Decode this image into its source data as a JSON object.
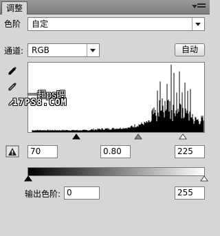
{
  "panel": {
    "tab_title": "调整"
  },
  "preset": {
    "label": "色阶",
    "value": "自定"
  },
  "channel": {
    "label": "通道:",
    "value": "RGB"
  },
  "auto_button": "自动",
  "watermark": {
    "line1": "一起ps吧",
    "line2": "17PS8.COM"
  },
  "input_levels": {
    "black": "70",
    "gamma": "0.80",
    "white": "225"
  },
  "output_levels": {
    "label": "输出色阶:",
    "black": "0",
    "white": "255"
  },
  "icons": [
    "menu-icon",
    "black-point-eyedropper-icon",
    "gray-point-eyedropper-icon",
    "white-point-eyedropper-icon",
    "clipping-warning-icon"
  ],
  "colors": {
    "background": "#d6d6d6",
    "histogram": "#000000"
  }
}
